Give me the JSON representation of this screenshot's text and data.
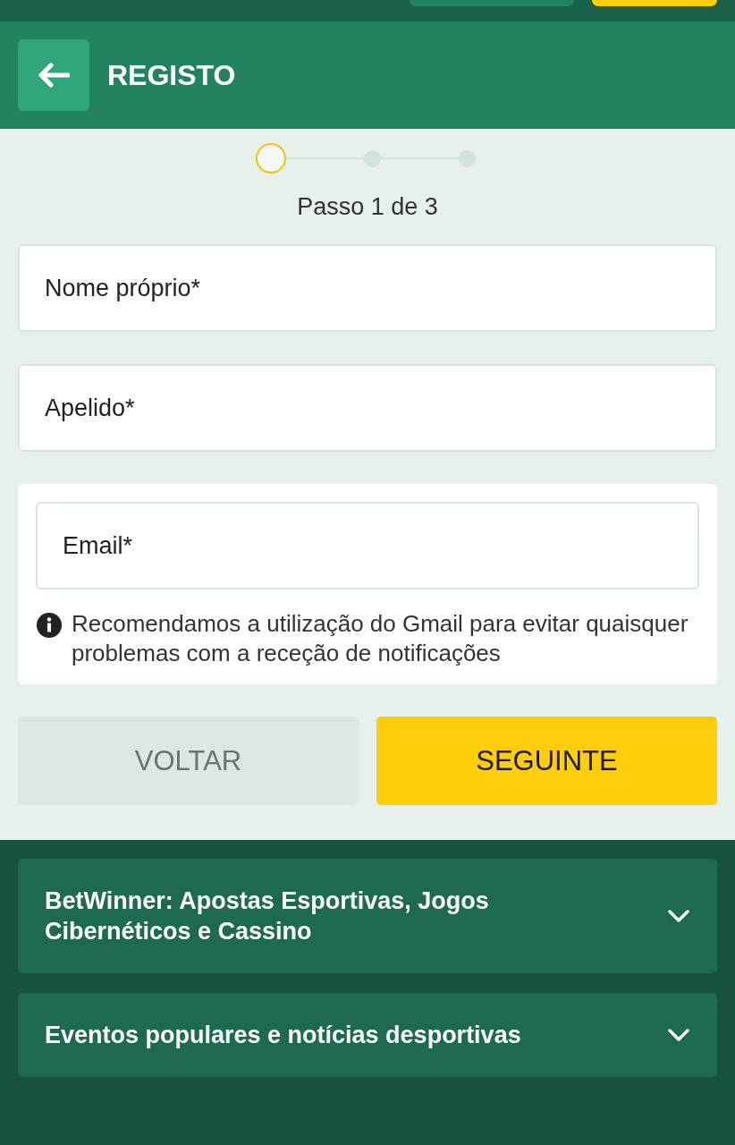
{
  "header": {
    "title": "REGISTO"
  },
  "stepper": {
    "steps": [
      {
        "selected": true
      },
      {
        "selected": false
      },
      {
        "selected": false
      }
    ],
    "caption": "Passo 1 de 3"
  },
  "fields": [
    {
      "placeholder": "Nome próprio*"
    },
    {
      "placeholder": "Apelido*"
    }
  ],
  "email": {
    "placeholder": "Email*",
    "hint": "Recomendamos a utilização do Gmail para evitar quaisquer problemas com a receção de notificações"
  },
  "buttons": [
    {
      "label": "VOLTAR",
      "kind": "secondary"
    },
    {
      "label": "SEGUINTE",
      "kind": "primary"
    }
  ],
  "accordion": [
    {
      "title": "BetWinner: Apostas Esportivas, Jogos Cibernéticos e Cassino",
      "expanded": false
    },
    {
      "title": "Eventos populares e notícias desportivas",
      "expanded": false
    }
  ]
}
